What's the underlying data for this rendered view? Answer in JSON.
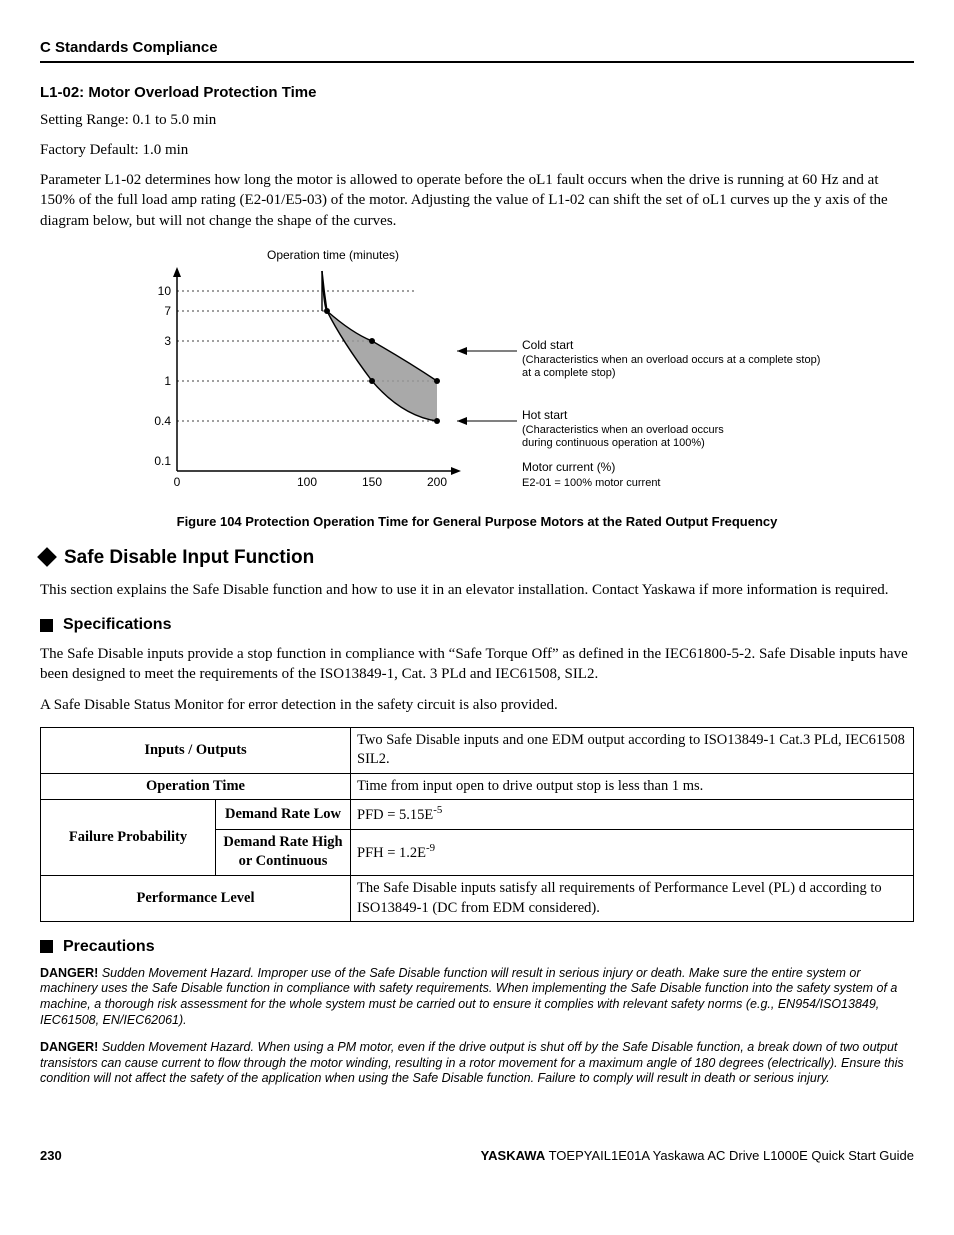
{
  "header": {
    "section": "C  Standards Compliance"
  },
  "param": {
    "code_label": "L1-02:  Motor Overload Protection Time",
    "setting_range": "Setting Range: 0.1 to 5.0 min",
    "factory_default": "Factory Default: 1.0 min",
    "description": "Parameter L1-02 determines how long the motor is allowed to operate before the oL1 fault occurs when the drive is running at 60 Hz and at 150% of the full load amp rating (E2-01/E5-03) of the motor. Adjusting the value of L1-02 can shift the set of oL1 curves up the y axis of the diagram below, but will not change the shape of the curves."
  },
  "figure": {
    "caption": "Figure 104  Protection Operation Time for General Purpose Motors at the Rated Output Frequency",
    "y_axis_label": "Operation time (minutes)",
    "x_axis_label": "Motor current (%)",
    "x_axis_note": "E2-01 = 100% motor current",
    "cold_label": "Cold start",
    "cold_note": "(Characteristics when an overload occurs at a complete stop)",
    "hot_label": "Hot start",
    "hot_note1": "(Characteristics when an overload occurs",
    "hot_note2": "during continuous operation at 100%)",
    "x_ticks": [
      "0",
      "100",
      "150",
      "200"
    ],
    "y_ticks": [
      "0.1",
      "0.4",
      "1",
      "3",
      "7",
      "10"
    ]
  },
  "chart_data": {
    "type": "line",
    "title": "Protection Operation Time for General Purpose Motors at the Rated Output Frequency",
    "xlabel": "Motor current (%)",
    "ylabel": "Operation time (minutes)",
    "x_ticks": [
      0,
      100,
      150,
      200
    ],
    "y_ticks_log": [
      0.1,
      0.4,
      1,
      3,
      7,
      10
    ],
    "series": [
      {
        "name": "Cold start",
        "x": [
          110,
          150,
          200
        ],
        "y": [
          10,
          3,
          1
        ],
        "note": "Characteristics when an overload occurs at a complete stop"
      },
      {
        "name": "Hot start",
        "x": [
          110,
          150,
          200
        ],
        "y": [
          7,
          1,
          0.4
        ],
        "note": "Characteristics when an overload occurs during continuous operation at 100%"
      }
    ],
    "yscale": "log",
    "xlim": [
      0,
      200
    ]
  },
  "safe_disable": {
    "title": "Safe Disable Input Function",
    "intro": "This section explains the Safe Disable function and how to use it in an elevator installation. Contact Yaskawa if more information is required.",
    "spec_title": "Specifications",
    "spec_intro1": "The Safe Disable inputs provide a stop function in compliance with “Safe Torque Off” as defined in the IEC61800-5-2. Safe Disable inputs have been designed to meet the requirements of the ISO13849-1, Cat. 3 PLd and IEC61508, SIL2.",
    "spec_intro2": "A Safe Disable Status Monitor for error detection in the safety circuit is also provided.",
    "table": {
      "inputs_outputs_label": "Inputs / Outputs",
      "inputs_outputs_value": "Two Safe Disable inputs and one EDM output according to ISO13849-1 Cat.3 PLd, IEC61508 SIL2.",
      "operation_time_label": "Operation Time",
      "operation_time_value": "Time from input open to drive output stop is less than 1 ms.",
      "failure_prob_label": "Failure Probability",
      "demand_low_label": "Demand Rate Low",
      "demand_low_value_prefix": "PFD = 5.15E",
      "demand_low_value_exp": "-5",
      "demand_high_label": "Demand Rate High or Continuous",
      "demand_high_value_prefix": "PFH = 1.2E",
      "demand_high_value_exp": "-9",
      "performance_label": "Performance Level",
      "performance_value": "The Safe Disable inputs satisfy all requirements of Performance Level (PL) d according to ISO13849-1 (DC from EDM considered)."
    },
    "precautions_title": "Precautions",
    "danger1_label": "DANGER!",
    "danger1_text": " Sudden Movement Hazard. Improper use of the Safe Disable function will result in serious injury or death. Make sure the entire system or machinery uses the Safe Disable function in compliance with safety requirements. When implementing the Safe Disable function into the safety system of a machine, a thorough risk assessment for the whole system must be carried out to ensure it complies with relevant safety norms (e.g., EN954/ISO13849, IEC61508, EN/IEC62061).",
    "danger2_label": "DANGER!",
    "danger2_text": " Sudden Movement Hazard. When using a PM motor, even if the drive output is shut off by the Safe Disable function, a break down of two output transistors can cause current to flow through the motor winding, resulting in a rotor movement for a maximum angle of 180 degrees (electrically). Ensure this condition will not affect the safety of the application when using the Safe Disable function. Failure to comply will result in death or serious injury."
  },
  "footer": {
    "page": "230",
    "brand": "YASKAWA",
    "doc": " TOEPYAIL1E01A Yaskawa AC Drive L1000E Quick Start Guide"
  }
}
